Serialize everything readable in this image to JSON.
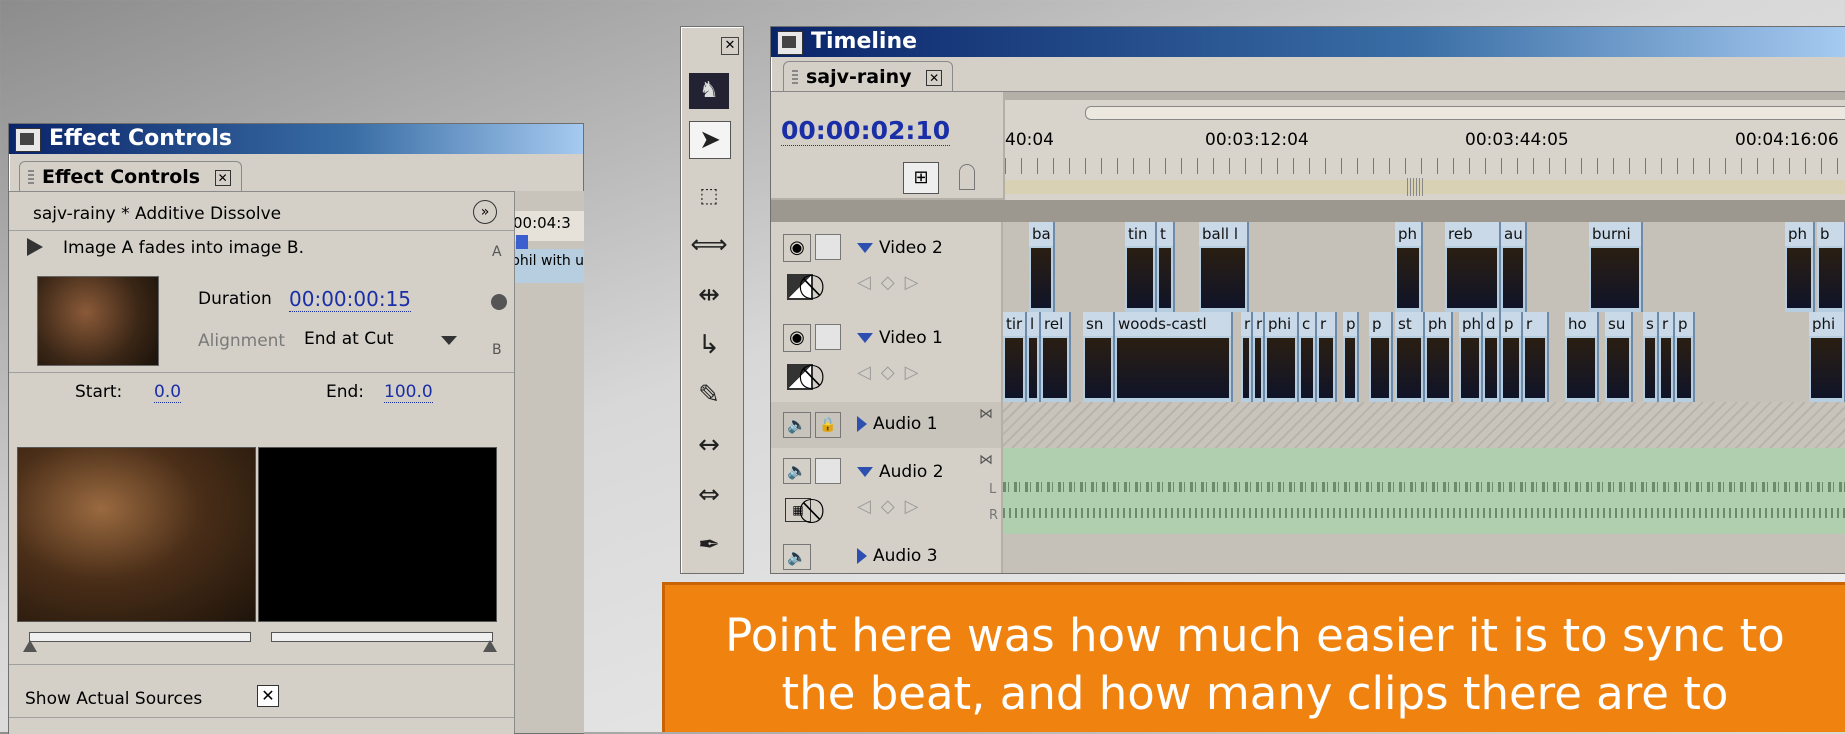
{
  "effect_controls": {
    "window_title": "Effect Controls",
    "tab_label": "Effect Controls",
    "clip_effect": "sajv-rainy * Additive Dissolve",
    "description": "Image A fades into image B.",
    "duration_label": "Duration",
    "duration_value": "00:00:00:15",
    "alignment_label": "Alignment",
    "alignment_value": "End at Cut",
    "start_label": "Start:",
    "start_value": "0.0",
    "end_label": "End:",
    "end_value": "100.0",
    "side_a": "A",
    "side_b": "B",
    "show_sources_label": "Show Actual Sources",
    "mini_timecode": "00:04:3",
    "mini_clip": "phil with unconsc r"
  },
  "timeline": {
    "window_title": "Timeline",
    "sequence_tab": "sajv-rainy",
    "current_time": "00:00:02:10",
    "ruler_ticks": [
      "40:04",
      "00:03:12:04",
      "00:03:44:05",
      "00:04:16:06"
    ],
    "tracks": [
      {
        "name": "Video 2",
        "type": "video"
      },
      {
        "name": "Video 1",
        "type": "video"
      },
      {
        "name": "Audio 1",
        "type": "audio"
      },
      {
        "name": "Audio 2",
        "type": "audio"
      },
      {
        "name": "Audio 3",
        "type": "audio"
      }
    ],
    "video2_clips": [
      "ba",
      "tin",
      "t",
      "ball l",
      "ph",
      "reb",
      "au",
      "burni",
      "ph",
      "b"
    ],
    "video1_clips": [
      "tir",
      "l",
      "rel",
      "sn",
      "woods-castl",
      "r",
      "r",
      "phi",
      "c",
      "r",
      "p",
      "p",
      "st",
      "ph",
      "ph",
      "d",
      "p",
      "r",
      "ho",
      "su",
      "s",
      "r",
      "p",
      "phi"
    ],
    "audio_channel_l": "L",
    "audio_channel_r": "R"
  },
  "caption": {
    "text": "Point here was how much easier it is to sync to the beat, and how many clips there are to",
    "color": "#f0820f"
  }
}
